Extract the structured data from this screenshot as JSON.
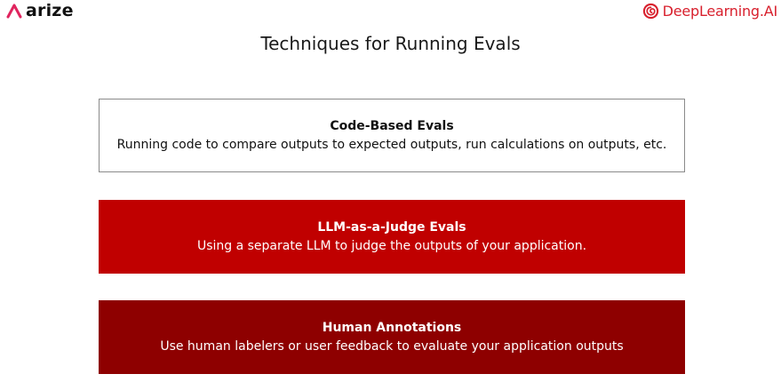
{
  "branding": {
    "left_logo_text": "arize",
    "right_logo_text": "DeepLearning.AI",
    "accent_color": "#d8202d"
  },
  "title": "Techniques for Running Evals",
  "techniques": [
    {
      "title": "Code-Based Evals",
      "description": "Running code to compare outputs to expected outputs, run calculations on outputs, etc.",
      "background": "#ffffff"
    },
    {
      "title": "LLM-as-a-Judge Evals",
      "description": "Using a separate LLM to judge the outputs of your application.",
      "background": "#c00000"
    },
    {
      "title": "Human Annotations",
      "description": "Use human labelers or user feedback to evaluate your application outputs",
      "background": "#8e0000"
    }
  ]
}
